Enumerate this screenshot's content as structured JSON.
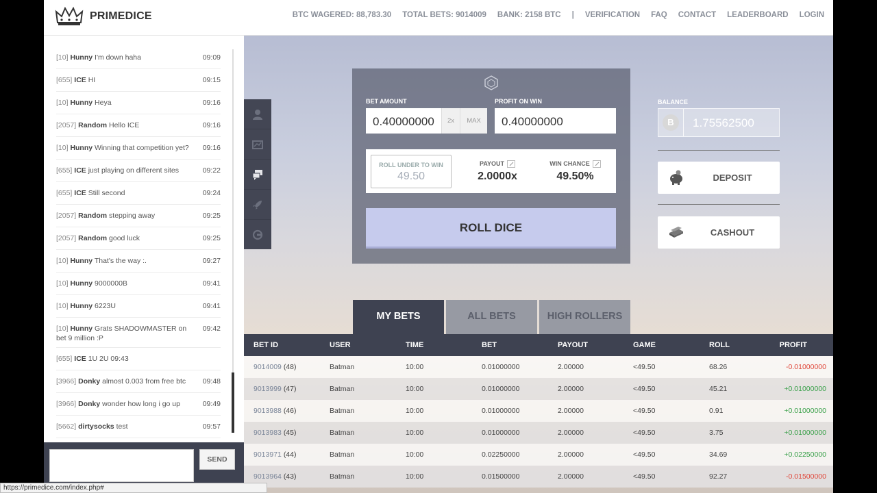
{
  "header": {
    "brand": "PRIMEDICE",
    "nav": [
      "BTC WAGERED: 88,783.30",
      "TOTAL BETS: 9014009",
      "BANK: 2158 BTC",
      "|",
      "VERIFICATION",
      "FAQ",
      "CONTACT",
      "LEADERBOARD",
      "LOGIN"
    ]
  },
  "chat": {
    "messages": [
      {
        "level": "[10]",
        "user": "Hunny",
        "text": " I'm down haha",
        "time": "09:09"
      },
      {
        "level": "[655]",
        "user": "ICE",
        "text": " HI",
        "time": "09:15"
      },
      {
        "level": "[10]",
        "user": "Hunny",
        "text": " Heya",
        "time": "09:16"
      },
      {
        "level": "[2057]",
        "user": "Random",
        "text": " Hello ICE",
        "time": "09:16"
      },
      {
        "level": "[10]",
        "user": "Hunny",
        "text": " Winning that competition yet?",
        "time": "09:16"
      },
      {
        "level": "[655]",
        "user": "ICE",
        "text": " just playing on different sites",
        "time": "09:22"
      },
      {
        "level": "[655]",
        "user": "ICE",
        "text": " Still second",
        "time": "09:24"
      },
      {
        "level": "[2057]",
        "user": "Random",
        "text": " stepping away",
        "time": "09:25"
      },
      {
        "level": "[2057]",
        "user": "Random",
        "text": " good luck",
        "time": "09:25"
      },
      {
        "level": "[10]",
        "user": "Hunny",
        "text": " That's the way :.",
        "time": "09:27"
      },
      {
        "level": "[10]",
        "user": "Hunny",
        "text": " 9000000B",
        "time": "09:41"
      },
      {
        "level": "[10]",
        "user": "Hunny",
        "text": " 6223U",
        "time": "09:41"
      },
      {
        "level": "[10]",
        "user": "Hunny",
        "text": " Grats SHADOWMASTER on bet 9 million :P",
        "time": "09:42"
      },
      {
        "level": "[655]",
        "user": "ICE",
        "text": " 1U 2U 09:43",
        "time": ""
      },
      {
        "level": "[3966]",
        "user": "Donky",
        "text": " almost 0.003 from free btc",
        "time": "09:48"
      },
      {
        "level": "[3966]",
        "user": "Donky",
        "text": " wonder how long i go up",
        "time": "09:49"
      },
      {
        "level": "[5662]",
        "user": "dirtysocks",
        "text": " test",
        "time": "09:57"
      }
    ],
    "send_label": "SEND",
    "input_value": ""
  },
  "status_url": "https://primedice.com/index.php#",
  "bet": {
    "bet_amount_label": "BET AMOUNT",
    "bet_amount": "0.40000000",
    "double_label": "2x",
    "max_label": "MAX",
    "profit_label": "PROFIT ON WIN",
    "profit": "0.40000000",
    "roll_under_label": "ROLL UNDER TO WIN",
    "roll_under": "49.50",
    "payout_label": "PAYOUT",
    "payout": "2.0000x",
    "win_chance_label": "WIN CHANCE",
    "win_chance": "49.50%",
    "roll_label": "ROLL DICE"
  },
  "account": {
    "balance_label": "BALANCE",
    "balance": "1.75562500",
    "btc_symbol": "B",
    "deposit_label": "DEPOSIT",
    "cashout_label": "CASHOUT"
  },
  "tabs": [
    "MY BETS",
    "ALL BETS",
    "HIGH ROLLERS"
  ],
  "table": {
    "headers": [
      "BET ID",
      "USER",
      "TIME",
      "BET",
      "PAYOUT",
      "GAME",
      "ROLL",
      "PROFIT"
    ],
    "rows": [
      {
        "id": "9014009",
        "n": "(48)",
        "user": "Batman",
        "time": "10:00",
        "bet": "0.01000000",
        "payout": "2.00000",
        "game": "<49.50",
        "roll": "68.26",
        "profit": "-0.01000000",
        "sign": "neg"
      },
      {
        "id": "9013999",
        "n": "(47)",
        "user": "Batman",
        "time": "10:00",
        "bet": "0.01000000",
        "payout": "2.00000",
        "game": "<49.50",
        "roll": "45.21",
        "profit": "+0.01000000",
        "sign": "pos"
      },
      {
        "id": "9013988",
        "n": "(46)",
        "user": "Batman",
        "time": "10:00",
        "bet": "0.01000000",
        "payout": "2.00000",
        "game": "<49.50",
        "roll": "0.91",
        "profit": "+0.01000000",
        "sign": "pos"
      },
      {
        "id": "9013983",
        "n": "(45)",
        "user": "Batman",
        "time": "10:00",
        "bet": "0.01000000",
        "payout": "2.00000",
        "game": "<49.50",
        "roll": "3.75",
        "profit": "+0.01000000",
        "sign": "pos"
      },
      {
        "id": "9013971",
        "n": "(44)",
        "user": "Batman",
        "time": "10:00",
        "bet": "0.02250000",
        "payout": "2.00000",
        "game": "<49.50",
        "roll": "34.69",
        "profit": "+0.02250000",
        "sign": "pos"
      },
      {
        "id": "9013964",
        "n": "(43)",
        "user": "Batman",
        "time": "10:00",
        "bet": "0.01500000",
        "payout": "2.00000",
        "game": "<49.50",
        "roll": "92.27",
        "profit": "-0.01500000",
        "sign": "neg"
      }
    ]
  }
}
